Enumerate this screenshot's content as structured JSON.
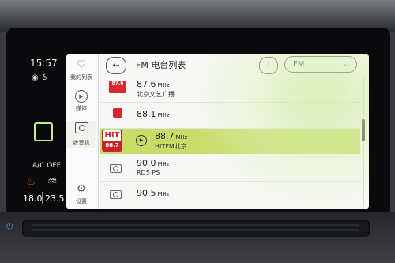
{
  "status": {
    "clock": "15:57",
    "icons": [
      "globe-icon",
      "person-icon"
    ]
  },
  "climate": {
    "ac_label": "A/C OFF",
    "temp_left": "18.0",
    "temp_right": "23.5",
    "seat_heat_color": "#d93426"
  },
  "nav": [
    {
      "label": "我的列表",
      "icon": "heart-icon"
    },
    {
      "label": "媒体",
      "icon": "play-circle-icon"
    },
    {
      "label": "收音机",
      "icon": "radio-icon",
      "active": true
    },
    {
      "label": "设置",
      "icon": "gear-icon"
    }
  ],
  "header": {
    "back_symbol": "⇠",
    "title": "FM 电台列表",
    "band": "FM"
  },
  "stations": [
    {
      "freq": "87.6",
      "unit": "MHz",
      "name": "北京文艺广播",
      "logo": "87.6"
    },
    {
      "freq": "88.1",
      "unit": "MHz",
      "name": "",
      "logo": ""
    },
    {
      "freq": "88.7",
      "unit": "MHz",
      "name": "HITFM北京",
      "logo_top": "HIT",
      "logo_num": "88.7",
      "selected": true
    },
    {
      "freq": "90.0",
      "unit": "MHz",
      "name": "RDS PS",
      "logo": ""
    },
    {
      "freq": "90.5",
      "unit": "MHz",
      "name": "",
      "logo": ""
    }
  ],
  "colors": {
    "accent": "#c9dc68",
    "highlight_border": "#c8ef86",
    "power": "#4d8bd8"
  }
}
